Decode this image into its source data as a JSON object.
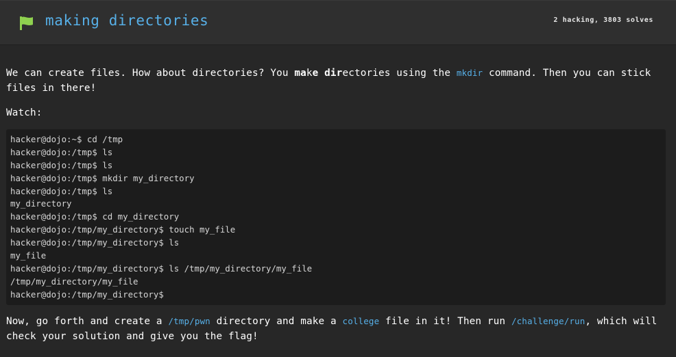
{
  "header": {
    "title": "making directories",
    "stats": "2 hacking, 3803 solves",
    "flag_color": "#8fd14f",
    "title_color": "#57b0e8"
  },
  "description": {
    "intro_1": "We can create files. How about directories? You ",
    "intro_ma": "ma",
    "intro_k": "k",
    "intro_e": "e ",
    "intro_dir": "dir",
    "intro_2": "ectories using the ",
    "intro_cmd": "mkdir",
    "intro_3": " command. Then you can stick files in there!",
    "watch": "Watch:",
    "outro_1": "Now, go forth and create a ",
    "outro_path": "/tmp/pwn",
    "outro_2": " directory and make a ",
    "outro_file": "college",
    "outro_3": " file in it! Then run ",
    "outro_run": "/challenge/run",
    "outro_4": ", which will check your solution and give you the flag!"
  },
  "terminal": {
    "lines": [
      "hacker@dojo:~$ cd /tmp",
      "hacker@dojo:/tmp$ ls",
      "hacker@dojo:/tmp$ ls",
      "hacker@dojo:/tmp$ mkdir my_directory",
      "hacker@dojo:/tmp$ ls",
      "my_directory",
      "hacker@dojo:/tmp$ cd my_directory",
      "hacker@dojo:/tmp/my_directory$ touch my_file",
      "hacker@dojo:/tmp/my_directory$ ls",
      "my_file",
      "hacker@dojo:/tmp/my_directory$ ls /tmp/my_directory/my_file",
      "/tmp/my_directory/my_file",
      "hacker@dojo:/tmp/my_directory$"
    ]
  }
}
